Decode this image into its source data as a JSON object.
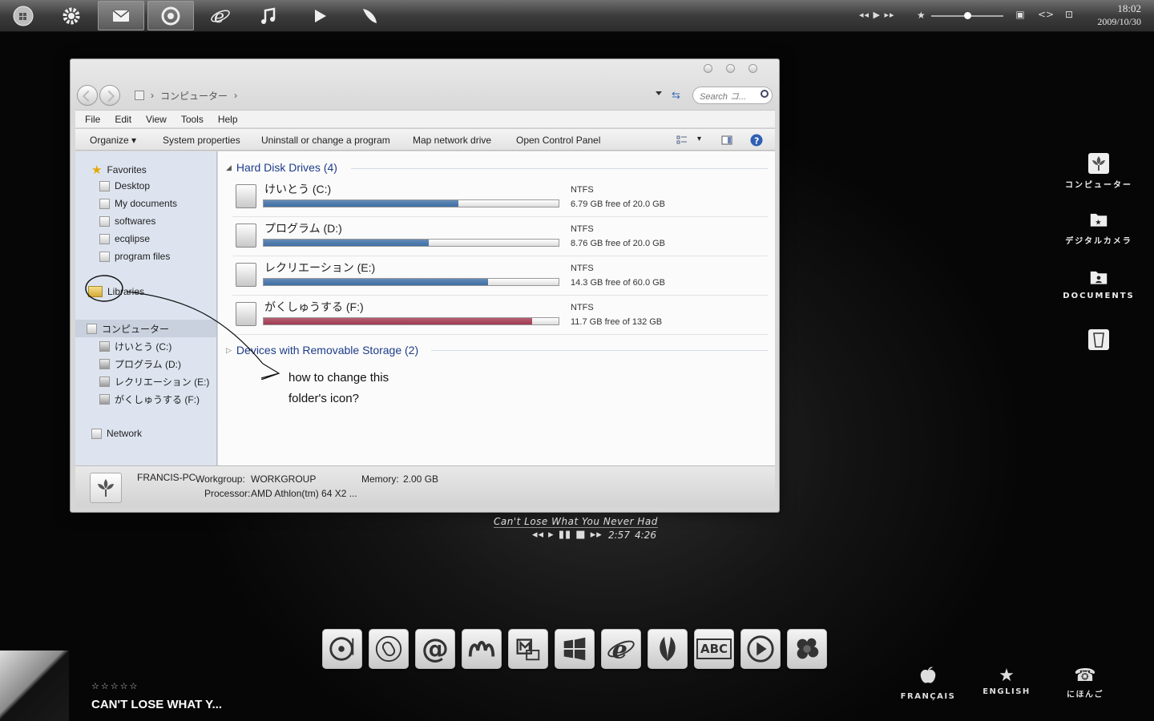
{
  "topbar": {
    "icons": [
      "windows-orb-icon",
      "gear-icon",
      "mail-icon",
      "chrome-icon",
      "internet-explorer-icon",
      "music-note-icon",
      "play-icon",
      "feather-icon"
    ],
    "media_controls": "◂◂ ▶ ▸▸",
    "clock": {
      "time": "18:02",
      "date": "2009/10/30"
    }
  },
  "window": {
    "address": {
      "crumb": "コンピューター"
    },
    "search_placeholder": "Search コ...",
    "menu": [
      "File",
      "Edit",
      "View",
      "Tools",
      "Help"
    ],
    "toolbar": {
      "organize": "Organize",
      "system_properties": "System properties",
      "uninstall": "Uninstall or change a program",
      "map_drive": "Map network drive",
      "control_panel": "Open Control Panel"
    },
    "nav": {
      "favorites": "Favorites",
      "favorite_items": [
        "Desktop",
        "My documents",
        "softwares",
        "ecqlipse",
        "program files"
      ],
      "libraries": "Libraries",
      "computer": "コンピューター",
      "drives": [
        "けいとう (C:)",
        "プログラム (D:)",
        "レクリエーション (E:)",
        "がくしゅうする (F:)"
      ],
      "network": "Network"
    },
    "groups": {
      "hdd": "Hard Disk Drives (4)",
      "removable": "Devices with Removable Storage (2)"
    },
    "drives": [
      {
        "name": "けいとう (C:)",
        "fs": "NTFS",
        "free": "6.79 GB free of 20.0 GB",
        "used_fraction": 0.66,
        "color": "#3f6fa6"
      },
      {
        "name": "プログラム (D:)",
        "fs": "NTFS",
        "free": "8.76 GB free of 20.0 GB",
        "used_fraction": 0.56,
        "color": "#3f6fa6"
      },
      {
        "name": "レクリエーション (E:)",
        "fs": "NTFS",
        "free": "14.3 GB free of 60.0 GB",
        "used_fraction": 0.76,
        "color": "#3f6fa6"
      },
      {
        "name": "がくしゅうする (F:)",
        "fs": "NTFS",
        "free": "11.7 GB free of 132 GB",
        "used_fraction": 0.91,
        "color": "#a33a52"
      }
    ],
    "annotation": {
      "line1": "how to change this",
      "line2": "folder's icon?"
    },
    "details": {
      "pc_name": "FRANCIS-PC",
      "workgroup_label": "Workgroup:",
      "workgroup": "WORKGROUP",
      "memory_label": "Memory:",
      "memory": "2.00 GB",
      "processor_label": "Processor:",
      "processor": "AMD Athlon(tm) 64 X2 ..."
    }
  },
  "desktop_icons": [
    {
      "label": "コンピューター"
    },
    {
      "label": "デジタルカメラ"
    },
    {
      "label": "DOCUMENTS"
    },
    {
      "label": ""
    }
  ],
  "player": {
    "title": "Can't Lose What You Never Had",
    "controls": "◂◂ ▸ ▮▮ ■ ▸▸",
    "elapsed": "2:57",
    "total": "4:26"
  },
  "dock": {
    "labels": {
      "at": "@",
      "abc": "ABC"
    }
  },
  "now_playing": {
    "stars": "☆☆☆☆☆",
    "title": "CAN'T LOSE WHAT Y..."
  },
  "languages": [
    {
      "label": "FRANÇAIS"
    },
    {
      "label": "ENGLISH"
    },
    {
      "label": "にほんご"
    }
  ]
}
